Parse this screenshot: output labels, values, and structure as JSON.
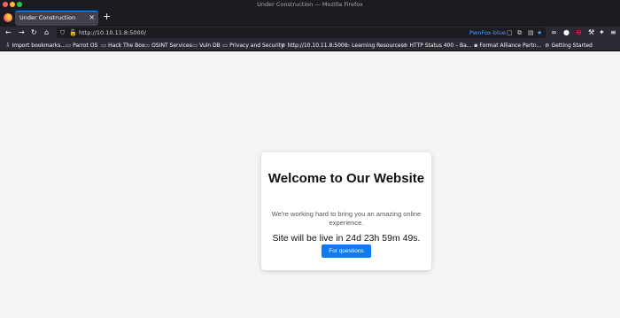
{
  "window": {
    "title": "Under Construction — Mozilla Firefox"
  },
  "tabs": [
    {
      "label": "Under Construction"
    }
  ],
  "toolbar": {
    "url": "http://10.10.11.8:5000/",
    "container": "PwnFox-blue"
  },
  "bookmarks": [
    {
      "label": "Import bookmarks...",
      "icon": "import-icon"
    },
    {
      "label": "Parrot OS",
      "icon": "folder-icon"
    },
    {
      "label": "Hack The Box",
      "icon": "folder-icon"
    },
    {
      "label": "OSINT Services",
      "icon": "folder-icon"
    },
    {
      "label": "Vuln DB",
      "icon": "folder-icon"
    },
    {
      "label": "Privacy and Security",
      "icon": "folder-icon"
    },
    {
      "label": "http://10.10.11.8:5000",
      "icon": "globe-icon"
    },
    {
      "label": "Learning Resources",
      "icon": "folder-icon"
    },
    {
      "label": "HTTP Status 400 – Ba...",
      "icon": "globe-icon"
    },
    {
      "label": "Format Alliance Partn...",
      "icon": "page-icon"
    },
    {
      "label": "Getting Started",
      "icon": "globe-icon"
    }
  ],
  "content": {
    "heading": "Welcome to Our Website",
    "message": "We're working hard to bring you an amazing online experience.",
    "countdown": "Site will be live in 24d 23h 59m 49s.",
    "button_label": "For questions"
  },
  "colors": {
    "accent": "#0d7cf2",
    "tab_highlight": "#2b8cf3",
    "container": "#45a1ff"
  }
}
